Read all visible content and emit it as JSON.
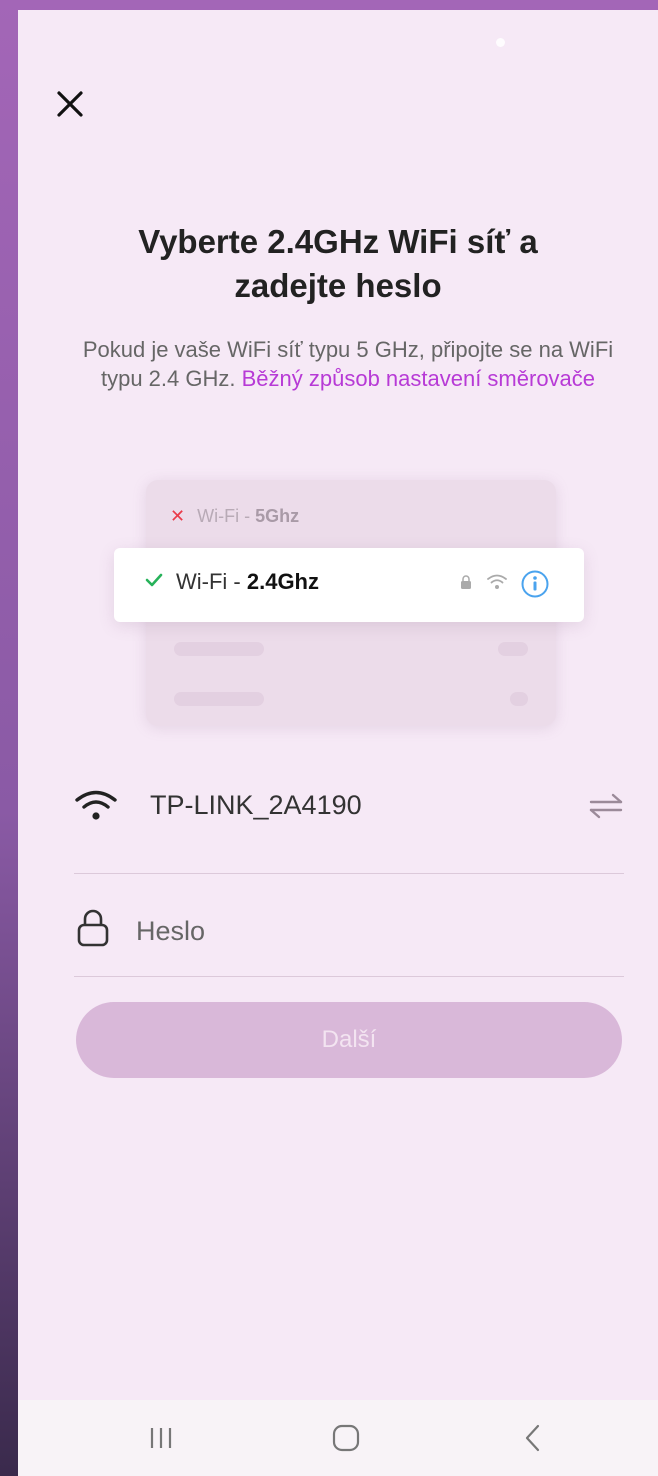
{
  "header": {
    "close_icon": "close-icon"
  },
  "main": {
    "title": "Vyberte 2.4GHz WiFi síť a zadejte heslo",
    "subtitle_text": "Pokud je vaše WiFi síť typu 5 GHz, připojte se na WiFi typu 2.4 GHz.",
    "subtitle_link": "Běžný způsob nastavení směrovače"
  },
  "illustration": {
    "row_5g_prefix": "Wi-Fi - ",
    "row_5g_band": "5Ghz",
    "row_24g_prefix": "Wi-Fi - ",
    "row_24g_band": "2.4Ghz"
  },
  "form": {
    "ssid": "TP-LINK_2A4190",
    "password_placeholder": "Heslo",
    "next_label": "Další"
  },
  "colors": {
    "accent_link": "#b73ad6",
    "button_disabled": "#d9b8d9",
    "background": "#f6e9f6"
  },
  "navbar": {
    "recents_icon": "recents-icon",
    "home_icon": "home-icon",
    "back_icon": "back-icon"
  }
}
